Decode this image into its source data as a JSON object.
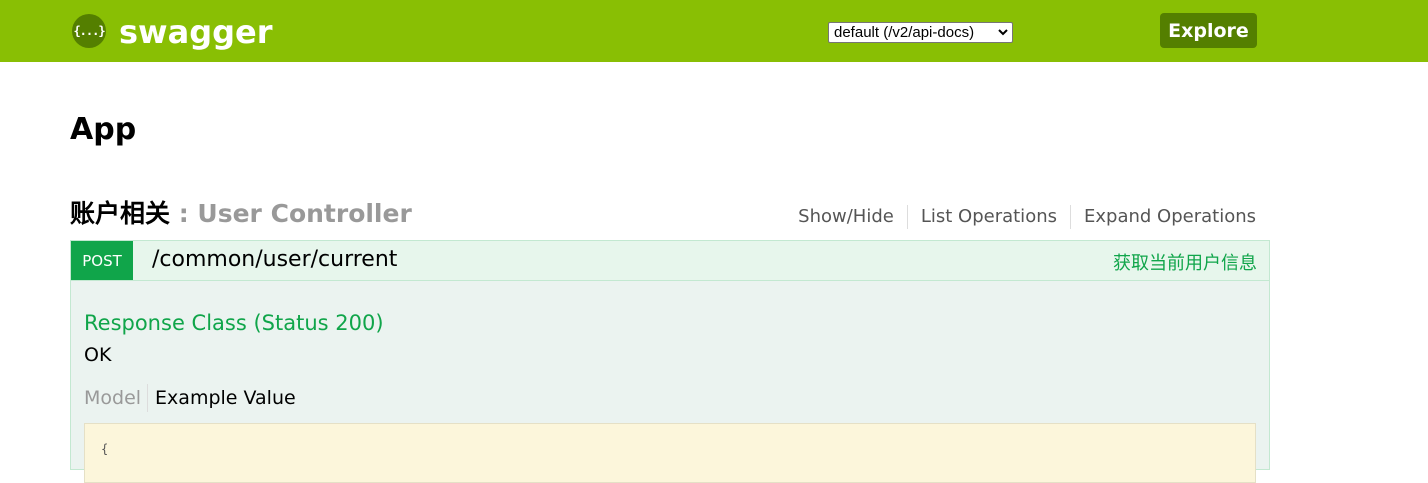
{
  "header": {
    "logo_icon_text": "{...}",
    "logo_text": "swagger",
    "spec_select_value": "default (/v2/api-docs)",
    "explore_label": "Explore",
    "colors": {
      "bar": "#89bf04",
      "dark": "#547f00"
    }
  },
  "main": {
    "app_title": "App"
  },
  "resource": {
    "name_cn": "账户相关",
    "separator": " : ",
    "name_en": "User Controller",
    "actions": [
      "Show/Hide",
      "List Operations",
      "Expand Operations"
    ]
  },
  "operation": {
    "method": "POST",
    "path": "/common/user/current",
    "summary": "获取当前用户信息",
    "response_class_heading": "Response Class (Status 200)",
    "response_type": "OK",
    "model_tab": "Model",
    "example_tab": "Example Value",
    "snippet_text": "{",
    "colors": {
      "method": "#10a54a",
      "background": "#ebf3f0"
    }
  }
}
